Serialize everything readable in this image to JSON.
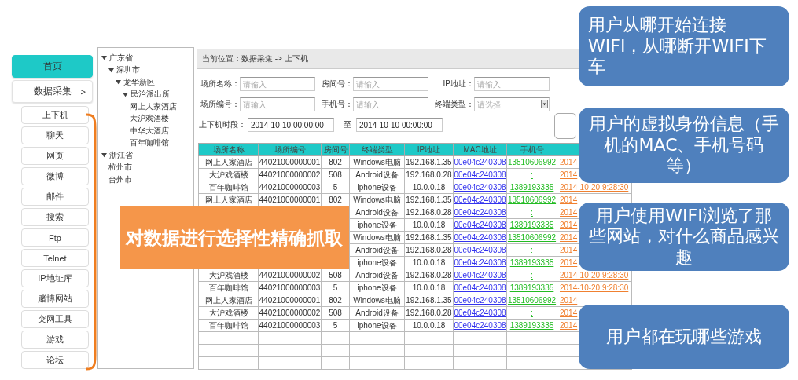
{
  "nav": {
    "items": [
      {
        "label": "首页",
        "selected": true
      },
      {
        "label": "数据采集",
        "selected": false,
        "chevron": ">"
      }
    ],
    "subitems": [
      "上下机",
      "聊天",
      "网页",
      "微博",
      "邮件",
      "搜索",
      "Ftp",
      "Telnet",
      "IP地址库",
      "赌博网站",
      "突网工具",
      "游戏",
      "论坛"
    ]
  },
  "tree": [
    {
      "label": "广东省",
      "expanded": true,
      "children": [
        {
          "label": "深圳市",
          "expanded": true,
          "children": [
            {
              "label": "龙华新区",
              "expanded": true,
              "children": [
                {
                  "label": "民治派出所",
                  "expanded": true,
                  "children": [
                    {
                      "label": "网上人家酒店"
                    },
                    {
                      "label": "大沪戏酒楼"
                    },
                    {
                      "label": "中华大酒店"
                    },
                    {
                      "label": "百年咖啡馆"
                    }
                  ]
                }
              ]
            }
          ]
        }
      ]
    },
    {
      "label": "浙江省",
      "expanded": true,
      "children": [
        {
          "label": "杭州市"
        },
        {
          "label": "台州市"
        }
      ]
    }
  ],
  "breadcrumb": "当前位置：数据采集 -> 上下机",
  "filters": [
    {
      "kind": "input",
      "label": "场所名称：",
      "placeholder": "请输入"
    },
    {
      "kind": "input",
      "label": "房间号：",
      "placeholder": "请输入"
    },
    {
      "kind": "input",
      "label": "IP地址：",
      "placeholder": "请输入"
    },
    {
      "kind": "input",
      "label": "场所编号：",
      "placeholder": "请输入"
    },
    {
      "kind": "input",
      "label": "手机号：",
      "placeholder": "请输入"
    },
    {
      "kind": "select",
      "label": "终端类型：",
      "placeholder": "请选择"
    }
  ],
  "date_range": {
    "label": "上下机时段：",
    "from": "2014-10-10 00:00:00",
    "to_label": "至",
    "to": "2014-10-10 00:00:00"
  },
  "table": {
    "columns": [
      "场所名称",
      "场所编号",
      "房间号",
      "终端类型",
      "IP地址",
      "MAC地址",
      "手机号"
    ],
    "rows": [
      {
        "place": "网上人家酒店",
        "code": "44021000000001",
        "room": "802",
        "device": "Windows电脑",
        "ip": "192.168.1.35",
        "mac": "00e04c240308",
        "phone": "13510606992",
        "time": "2014"
      },
      {
        "place": "大沪戏酒楼",
        "code": "44021000000002",
        "room": "508",
        "device": "Android设备",
        "ip": "192.168.0.28",
        "mac": "00e04c240308",
        "phone": ":",
        "time": "2014"
      },
      {
        "place": "百年咖啡馆",
        "code": "44021000000003",
        "room": "5",
        "device": "iphone设备",
        "ip": "10.0.0.18",
        "mac": "00e04c240308",
        "phone": "1389193335",
        "time": "2014-10-20 9:28:30"
      },
      {
        "place": "网上人家酒店",
        "code": "44021000000001",
        "room": "802",
        "device": "Windows电脑",
        "ip": "192.168.1.35",
        "mac": "00e04c240308",
        "phone": "13510606992",
        "time": "2014"
      },
      {
        "device": "Android设备",
        "ip": "192.168.0.28",
        "mac": "00e04c240308",
        "phone": ":",
        "time": "2014"
      },
      {
        "device": "iphone设备",
        "ip": "10.0.0.18",
        "mac": "00e04c240308",
        "phone": "1389193335",
        "time": "2014"
      },
      {
        "device": "Windows电脑",
        "ip": "192.168.1.35",
        "mac": "00e04c240308",
        "phone": "13510606992",
        "time": "2014"
      },
      {
        "device": "Android设备",
        "ip": "192.168.0.28",
        "mac": "00e04c240308",
        "phone": ":",
        "time": "2014"
      },
      {
        "device": "iphone设备",
        "ip": "10.0.0.18",
        "mac": "00e04c240308",
        "phone": "1389193335",
        "time": "2014"
      },
      {
        "place": "大沪戏酒楼",
        "code": "44021000000002",
        "room": "508",
        "device": "Android设备",
        "ip": "192.168.0.28",
        "mac": "00e04c240308",
        "phone": ":",
        "time": "2014-10-20 9:28:30"
      },
      {
        "place": "百年咖啡馆",
        "code": "44021000000003",
        "room": "5",
        "device": "iphone设备",
        "ip": "10.0.0.18",
        "mac": "00e04c240308",
        "phone": "1389193335",
        "time": "2014-10-20 9:28:30"
      },
      {
        "place": "网上人家酒店",
        "code": "44021000000001",
        "room": "802",
        "device": "Windows电脑",
        "ip": "192.168.1.35",
        "mac": "00e04c240308",
        "phone": "13510606992",
        "time": "2014"
      },
      {
        "place": "大沪戏酒楼",
        "code": "44021000000002",
        "room": "508",
        "device": "Android设备",
        "ip": "192.168.0.28",
        "mac": "00e04c240308",
        "phone": ":",
        "time": "2014"
      },
      {
        "place": "百年咖啡馆",
        "code": "44021000000003",
        "room": "5",
        "device": "iphone设备",
        "ip": "10.0.0.18",
        "mac": "00e04c240308",
        "phone": "1389193335",
        "time": "2014"
      }
    ]
  },
  "banner": "对数据进行选择性精确抓取",
  "callouts": [
    "用户从哪开始连接WIFI，从哪断开WIFI下车",
    "用户的虚拟身份信息（手机的MAC、手机号码等）",
    "用户使用WIFI浏览了那些网站，对什么商品感兴趣",
    "用户都在玩哪些游戏"
  ]
}
